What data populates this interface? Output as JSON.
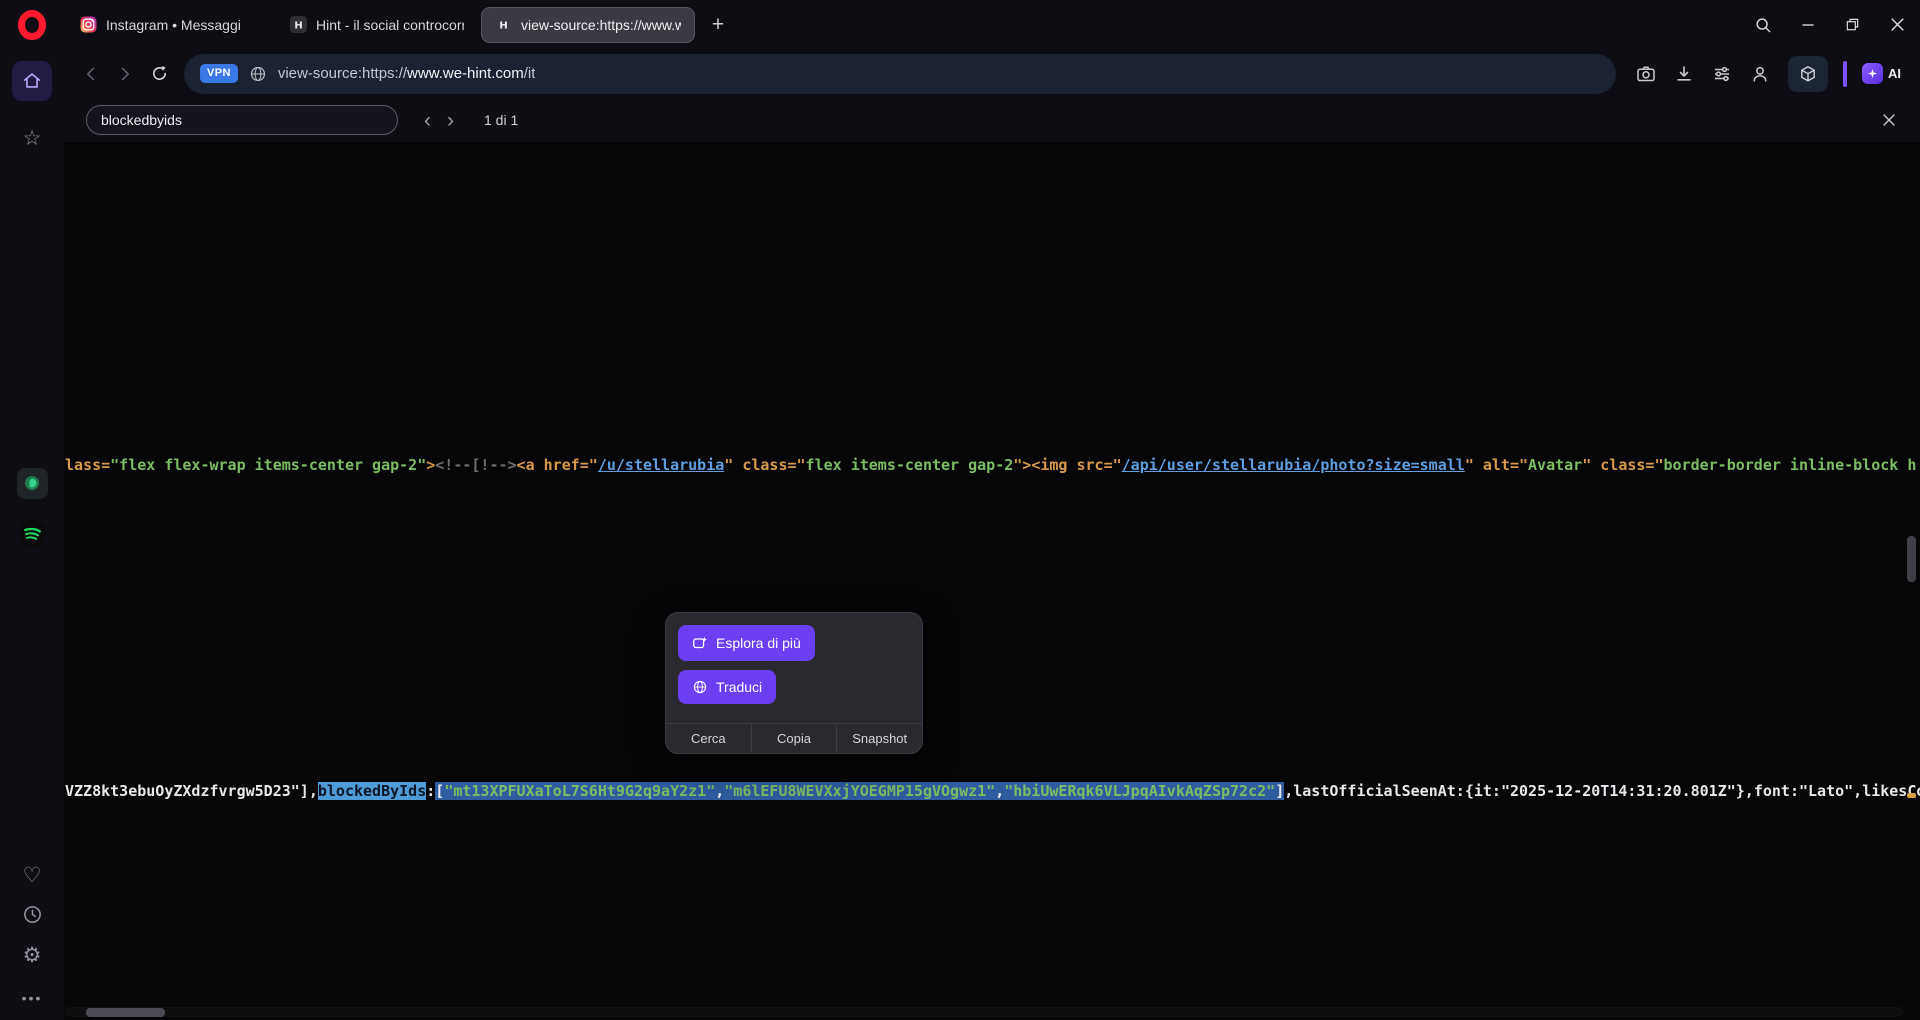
{
  "tabbar": {
    "tabs": [
      {
        "title": "Instagram • Messaggi"
      },
      {
        "title": "Hint - il social controcorre"
      },
      {
        "title": "view-source:https://www.w"
      }
    ]
  },
  "addressbar": {
    "vpn": "VPN",
    "url_scheme": "view-source:https://",
    "url_host": "www.we-hint.com",
    "url_path": "/it",
    "ai_label": "AI"
  },
  "findbar": {
    "query": "blockedbyids",
    "count": "1 di 1"
  },
  "popup": {
    "explore": "Esplora di più",
    "translate": "Traduci",
    "actions": [
      "Cerca",
      "Copia",
      "Snapshot"
    ]
  },
  "source": {
    "line1": [
      {
        "t": "lass=",
        "c": "attr"
      },
      {
        "t": "\"flex flex-wrap items-center gap-2\"",
        "c": "str"
      },
      {
        "t": ">",
        "c": "attr"
      },
      {
        "t": "<!--[!-->",
        "c": "com"
      },
      {
        "t": "<a href=\"",
        "c": "attr"
      },
      {
        "t": "/u/stellarubia",
        "c": "link"
      },
      {
        "t": "\" class=\"",
        "c": "attr"
      },
      {
        "t": "flex items-center gap-2",
        "c": "str"
      },
      {
        "t": "\"><img src=\"",
        "c": "attr"
      },
      {
        "t": "/api/user/stellarubia/photo?size=small",
        "c": "link"
      },
      {
        "t": "\" alt=\"",
        "c": "attr"
      },
      {
        "t": "Avatar",
        "c": "str"
      },
      {
        "t": "\" class=\"",
        "c": "attr"
      },
      {
        "t": "border-border inline-block h",
        "c": "str"
      }
    ],
    "line2": [
      {
        "t": "VZZ8kt3ebuOyZXdzfvrgw5D23\"],",
        "c": "plain"
      },
      {
        "t": "blockedByIds",
        "c": "match"
      },
      {
        "t": ":",
        "c": "plain"
      },
      {
        "t": "[",
        "c": "plain sel"
      },
      {
        "t": "\"mt13XPFUXaToL7S6Ht9G2q9aY2z1\"",
        "c": "str sel"
      },
      {
        "t": ",",
        "c": "plain sel"
      },
      {
        "t": "\"m6lEFU8WEVXxjYOEGMP15gVOgwz1\"",
        "c": "str sel"
      },
      {
        "t": ",",
        "c": "plain sel"
      },
      {
        "t": "\"hbiUwERqk6VLJpqAIvkAqZSp72c2\"",
        "c": "str sel"
      },
      {
        "t": "]",
        "c": "plain sel"
      },
      {
        "t": ",lastOfficialSeenAt:{it:\"2025-12-20T14:31:20.801Z\"},font:\"Lato\",likesCo",
        "c": "plain"
      }
    ]
  },
  "icons": {
    "new_tab": "+",
    "find_prev": "‹",
    "find_next": "›",
    "star": "☆",
    "heart": "♡",
    "gear": "⚙",
    "more_dots": "•••"
  },
  "colors": {
    "chrome_bg": "#0d0d13",
    "content_bg": "#060608",
    "accent_purple": "#6b3ef2",
    "vpn_blue": "#3a78e6",
    "attr_orange": "#d79a4a",
    "string_green": "#7cbd63",
    "link_blue": "#5f9fe0",
    "selection_blue": "#2d5c9f",
    "match_highlight": "#4f9bd8",
    "find_marker_orange": "#d9a13e",
    "opera_red": "#ff1b2d",
    "spotify_green": "#1ed760"
  }
}
